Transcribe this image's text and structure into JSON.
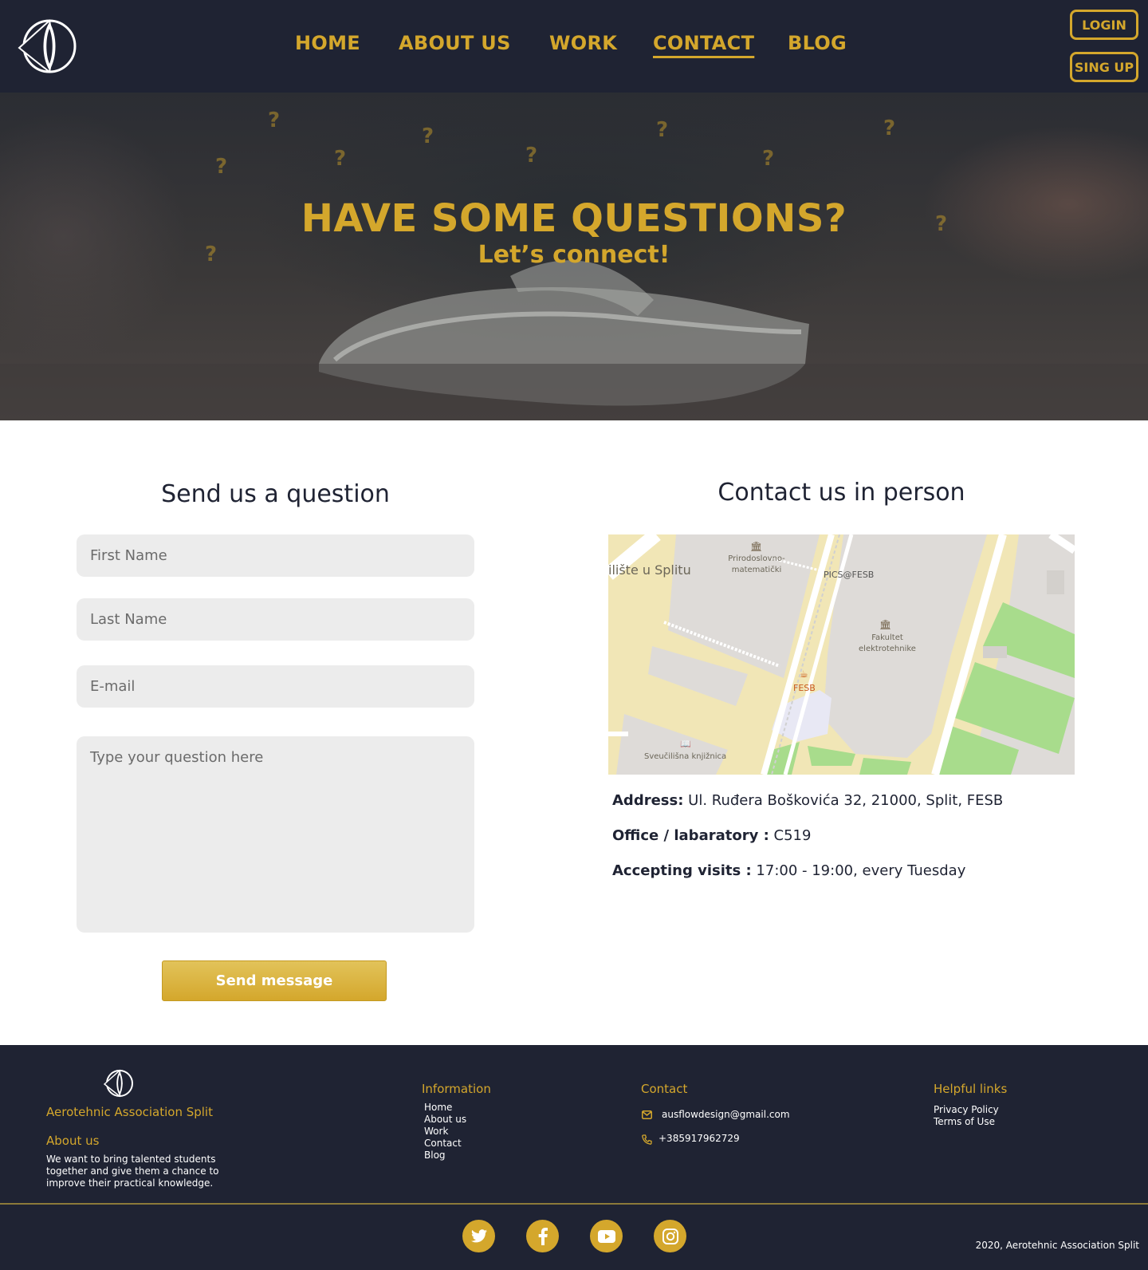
{
  "header": {
    "logo_icon": "compass-logo-icon",
    "nav": [
      {
        "label": "HOME"
      },
      {
        "label": "ABOUT US"
      },
      {
        "label": "WORK"
      },
      {
        "label": "CONTACT",
        "active": true
      },
      {
        "label": "BLOG"
      }
    ],
    "login_label": "LOGIN",
    "signup_label": "SING UP"
  },
  "hero": {
    "title": "HAVE SOME QUESTIONS?",
    "subtitle": "Let’s connect!",
    "question_mark": "?"
  },
  "form": {
    "title": "Send us a question",
    "first_name_placeholder": "First Name",
    "last_name_placeholder": "Last Name",
    "email_placeholder": "E-mail",
    "question_placeholder": "Type your question here",
    "send_label": "Send message"
  },
  "contact": {
    "title": "Contact us in person",
    "map": {
      "labels": [
        "ilište u Splitu",
        "Prirodoslovno-",
        "matematički",
        "PICS@FESB",
        "Fakultet",
        "elektrotehnike",
        "FESB",
        "Sveučilišna knjižnica"
      ]
    },
    "address_label": "Address:",
    "address_value": "Ul. Ruđera Boškovića 32, 21000, Split, FESB",
    "office_label": "Office / labaratory :",
    "office_value": "C519",
    "visits_label": "Accepting visits :",
    "visits_value": "17:00 - 19:00, every Tuesday"
  },
  "footer": {
    "org_name": "Aerotehnic Association Split",
    "about_title": "About us",
    "about_text": "We want to bring talented students together and give them a chance to improve their practical knowledge.",
    "information_title": "Information",
    "information_links": [
      "Home",
      "About us",
      "Work",
      "Contact",
      "Blog"
    ],
    "contact_title": "Contact",
    "email": "ausflowdesign@gmail.com",
    "phone": "+385917962729",
    "helpful_title": "Helpful links",
    "helpful_links": [
      "Privacy Policy",
      "Terms of Use"
    ],
    "social_icons": [
      "twitter-icon",
      "facebook-icon",
      "youtube-icon",
      "instagram-icon"
    ],
    "copyright": "2020, Aerotehnic Association Split"
  },
  "colors": {
    "navy": "#1f2333",
    "gold": "#d4a72c",
    "field_bg": "#ececec"
  }
}
